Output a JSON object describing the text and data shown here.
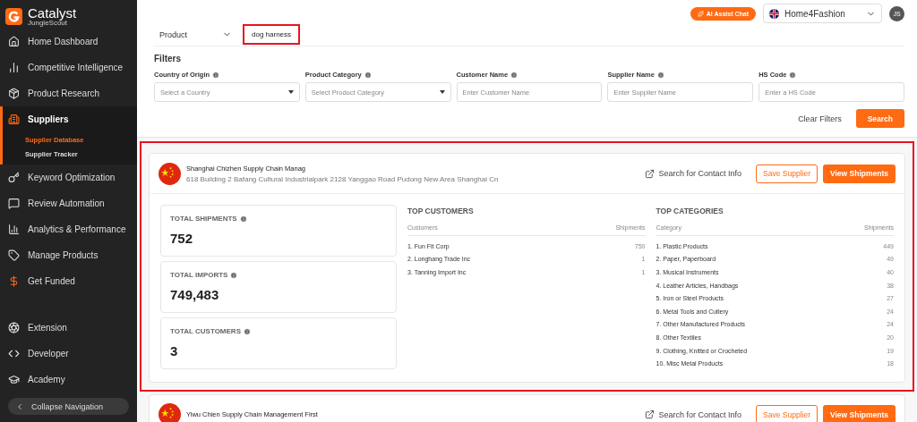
{
  "sidebar": {
    "logo": {
      "name": "Catalyst",
      "tagline": "JungleScout"
    },
    "items": [
      {
        "label": "Home Dashboard",
        "selected": false
      },
      {
        "label": "Competitive Intelligence",
        "selected": false
      },
      {
        "label": "Product Research",
        "selected": false
      },
      {
        "label": "Suppliers",
        "selected": true,
        "children": [
          {
            "label": "Supplier Database",
            "selected": true
          },
          {
            "label": "Supplier Tracker",
            "selected": false
          }
        ]
      },
      {
        "label": "Keyword Optimization",
        "selected": false
      },
      {
        "label": "Review Automation",
        "selected": false
      },
      {
        "label": "Analytics & Performance",
        "selected": false
      },
      {
        "label": "Manage Products",
        "selected": false
      },
      {
        "label": "Get Funded",
        "selected": false
      }
    ],
    "footer_items": [
      {
        "label": "Extension"
      },
      {
        "label": "Developer"
      },
      {
        "label": "Academy"
      }
    ],
    "collapse": "Collapse Navigation"
  },
  "header": {
    "ai_button": "AI Assist Chat",
    "store": "Home4Fashion",
    "avatar": "JS"
  },
  "search": {
    "type": "Product",
    "query": "dog harness",
    "highlighted": true
  },
  "filters": {
    "title": "Filters",
    "fields": [
      {
        "label": "Country of Origin",
        "placeholder": "Select a Country",
        "kind": "select"
      },
      {
        "label": "Product Category",
        "placeholder": "Select Product Category",
        "kind": "select"
      },
      {
        "label": "Customer Name",
        "placeholder": "Enter Customer Name",
        "kind": "text"
      },
      {
        "label": "Supplier Name",
        "placeholder": "Enter Supplier Name",
        "kind": "text"
      },
      {
        "label": "HS Code",
        "placeholder": "Enter a HS Code",
        "kind": "text"
      }
    ],
    "clear": "Clear Filters",
    "submit": "Search"
  },
  "suppliers": [
    {
      "name": "Shanghai Chizhen Supply Chain Manag",
      "address": "618 Building 2 Bafang Cultural Industrialpark 2128 Yanggao Road Pudong New Area Shanghai Cn",
      "contact": "Search for Contact Info",
      "save": "Save Supplier",
      "view": "View Shipments",
      "highlighted": true,
      "stats": [
        {
          "label": "TOTAL SHIPMENTS",
          "value": "752"
        },
        {
          "label": "TOTAL IMPORTS",
          "value": "749,483"
        },
        {
          "label": "TOTAL CUSTOMERS",
          "value": "3"
        }
      ],
      "top_customers": {
        "title": "TOP CUSTOMERS",
        "columns": [
          "Customers",
          "Shipments"
        ],
        "rows": [
          {
            "name": "1. Fun Fit Corp",
            "count": "750"
          },
          {
            "name": "2. Longhang Trade Inc",
            "count": "1"
          },
          {
            "name": "3. Tanning Import Inc",
            "count": "1"
          }
        ]
      },
      "top_categories": {
        "title": "TOP CATEGORIES",
        "columns": [
          "Category",
          "Shipments"
        ],
        "rows": [
          {
            "name": "1. Plastic Products",
            "count": "449"
          },
          {
            "name": "2. Paper, Paperboard",
            "count": "49"
          },
          {
            "name": "3. Musical Instruments",
            "count": "40"
          },
          {
            "name": "4. Leather Articles, Handbags",
            "count": "38"
          },
          {
            "name": "5. Iron or Steel Products",
            "count": "27"
          },
          {
            "name": "6. Metal Tools and Cutlery",
            "count": "24"
          },
          {
            "name": "7. Other Manufactured Products",
            "count": "24"
          },
          {
            "name": "8. Other Textiles",
            "count": "20"
          },
          {
            "name": "9. Clothing, Knitted or Crocheted",
            "count": "19"
          },
          {
            "name": "10. Misc Metal Products",
            "count": "18"
          }
        ]
      }
    },
    {
      "name": "Yiwu Chien Supply Chain Management First",
      "contact": "Search for Contact Info",
      "save": "Save Supplier",
      "view": "View Shipments",
      "highlighted": false
    }
  ]
}
